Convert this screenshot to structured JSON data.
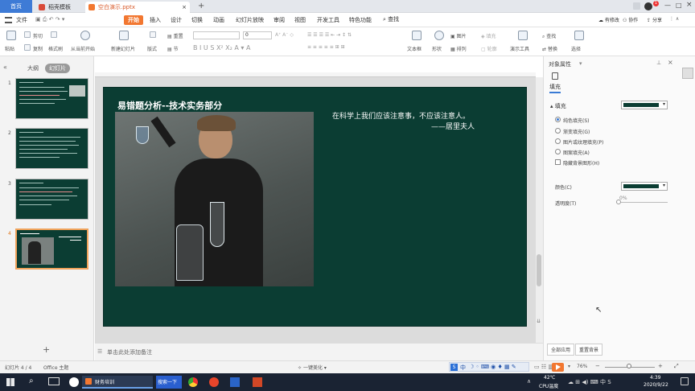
{
  "titlebar": {
    "tabs": [
      {
        "label": "首页",
        "color": "#3e7bd6"
      },
      {
        "label": "稻壳模板",
        "color": "#d94a38"
      },
      {
        "label": "空白演示.pptx",
        "color": "#f27730"
      }
    ],
    "add_tab": "+",
    "login_badge": "1"
  },
  "menubar": {
    "file": "文件",
    "items": [
      "开始",
      "插入",
      "设计",
      "切换",
      "动画",
      "幻灯片放映",
      "审阅",
      "视图",
      "开发工具",
      "特色功能"
    ],
    "search": "查找",
    "right": [
      "有修改",
      "协作",
      "分享"
    ]
  },
  "ribbon": {
    "paste": "粘贴",
    "cut": "剪切",
    "copy": "复制",
    "format_painter": "格式刷",
    "from_current": "从当前开始",
    "new_slide": "新建幻灯片",
    "layout": "版式",
    "section": "节",
    "reset": "重置",
    "font_size_value": "0",
    "textbox": "文本框",
    "shape": "形状",
    "arrange": "排列",
    "picture": "图片",
    "fill": "填充",
    "outline": "轮廓",
    "presenter": "演示工具",
    "find": "查找",
    "replace": "替换",
    "select": "选择"
  },
  "leftpanel": {
    "tab_outline": "大纲",
    "tab_slides": "幻灯片",
    "slide_numbers": [
      "1",
      "2",
      "3",
      "4"
    ],
    "add": "+"
  },
  "slide": {
    "title": "易错题分析--技术实务部分",
    "quote_line1": "在科学上我们应该注意事，不应该注意人。",
    "quote_line2": "——居里夫人",
    "bg_color": "#0b3d33"
  },
  "notes": {
    "placeholder": "单击此处添加备注"
  },
  "rpanel": {
    "title": "对象属性",
    "tab_fill": "填充",
    "section_fill": "填充",
    "options": [
      "纯色填充(S)",
      "渐变填充(G)",
      "图片或纹理填充(P)",
      "图案填充(A)"
    ],
    "hide_bg": "隐藏背景图形(H)",
    "color_label": "颜色(C)",
    "transparency_label": "透明度(T)",
    "transparency_value": "0%",
    "btn_apply_all": "全部应用",
    "btn_reset_bg": "重置背景",
    "fill_color": "#0b3d33"
  },
  "statusbar": {
    "slide_info": "幻灯片 4 / 4",
    "theme": "Office 主题",
    "beautify": "一键美化",
    "zoom": "76%",
    "ime": "中"
  },
  "taskbar": {
    "app1": "财务培训",
    "app2": "搜索一下",
    "temp": "42℃",
    "cpu": "CPU温度",
    "time": "4:39",
    "date": "2020/9/22"
  }
}
